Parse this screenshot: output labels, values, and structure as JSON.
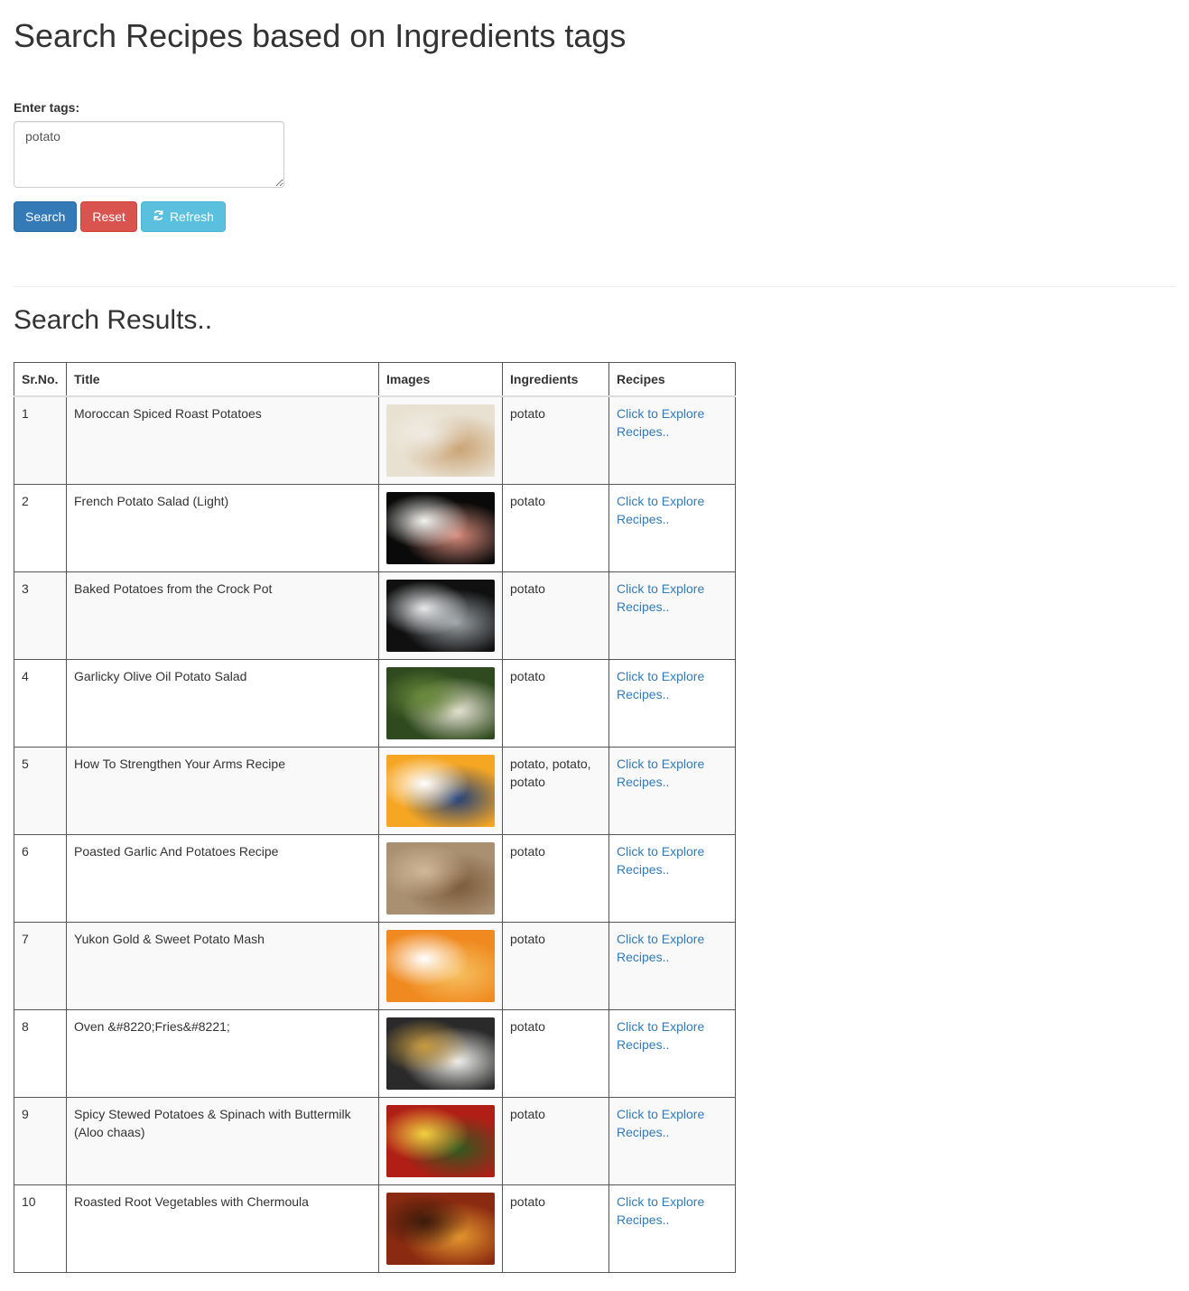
{
  "page": {
    "title": "Search Recipes based on Ingredients tags"
  },
  "form": {
    "tags_label": "Enter tags:",
    "tags_value": "potato",
    "search_label": "Search",
    "reset_label": "Reset",
    "refresh_label": "Refresh",
    "refresh_icon": "refresh-icon"
  },
  "results": {
    "title": "Search Results..",
    "headers": {
      "sr": "Sr.No.",
      "title": "Title",
      "images": "Images",
      "ingredients": "Ingredients",
      "recipes": "Recipes"
    },
    "rows": [
      {
        "sr": "1",
        "title": "Moroccan Spiced Roast Potatoes",
        "ingredients": "potato",
        "link": "Click to Explore Recipes..",
        "img": "roast-potatoes-photo",
        "colors": [
          "#e8e0d0",
          "#c8a070",
          "#f0ece4"
        ]
      },
      {
        "sr": "2",
        "title": "French Potato Salad (Light)",
        "ingredients": "potato",
        "link": "Click to Explore Recipes..",
        "img": "potato-salad-photo",
        "colors": [
          "#0a0a0a",
          "#d88a7a",
          "#f2f2ee"
        ]
      },
      {
        "sr": "3",
        "title": "Baked Potatoes from the Crock Pot",
        "ingredients": "potato",
        "link": "Click to Explore Recipes..",
        "img": "foil-potatoes-photo",
        "colors": [
          "#101010",
          "#9aa0a4",
          "#e6e8ea"
        ]
      },
      {
        "sr": "4",
        "title": "Garlicky Olive Oil Potato Salad",
        "ingredients": "potato",
        "link": "Click to Explore Recipes..",
        "img": "olive-oil-salad-photo",
        "colors": [
          "#2f4a1e",
          "#ece8d8",
          "#6a8a3a"
        ]
      },
      {
        "sr": "5",
        "title": "How To Strengthen Your Arms Recipe",
        "ingredients": "potato, potato, potato",
        "link": "Click to Explore Recipes..",
        "img": "cartoon-sailor-image",
        "colors": [
          "#f5a623",
          "#1f3f7a",
          "#ffffff"
        ]
      },
      {
        "sr": "6",
        "title": "Poasted Garlic And Potatoes Recipe",
        "ingredients": "potato",
        "link": "Click to Explore Recipes..",
        "img": "garlic-potatoes-photo",
        "colors": [
          "#a89070",
          "#7a5a3a",
          "#d0b898"
        ]
      },
      {
        "sr": "7",
        "title": "Yukon Gold & Sweet Potato Mash",
        "ingredients": "potato",
        "link": "Click to Explore Recipes..",
        "img": "potato-mash-photo",
        "colors": [
          "#f08a20",
          "#f6c060",
          "#ffffff"
        ]
      },
      {
        "sr": "8",
        "title": "Oven &#8220;Fries&#8221;",
        "ingredients": "potato",
        "link": "Click to Explore Recipes..",
        "img": "oven-fries-photo",
        "colors": [
          "#2a2a2a",
          "#f4f4f2",
          "#c89a40"
        ]
      },
      {
        "sr": "9",
        "title": "Spicy Stewed Potatoes & Spinach with Buttermilk (Aloo chaas)",
        "ingredients": "potato",
        "link": "Click to Explore Recipes..",
        "img": "stewed-potatoes-photo",
        "colors": [
          "#b01e16",
          "#2e5a20",
          "#f0d040"
        ]
      },
      {
        "sr": "10",
        "title": "Roasted Root Vegetables with Chermoula",
        "ingredients": "potato",
        "link": "Click to Explore Recipes..",
        "img": "root-vegetables-photo",
        "colors": [
          "#8a2a10",
          "#e89a30",
          "#3a1a0a"
        ]
      }
    ]
  }
}
